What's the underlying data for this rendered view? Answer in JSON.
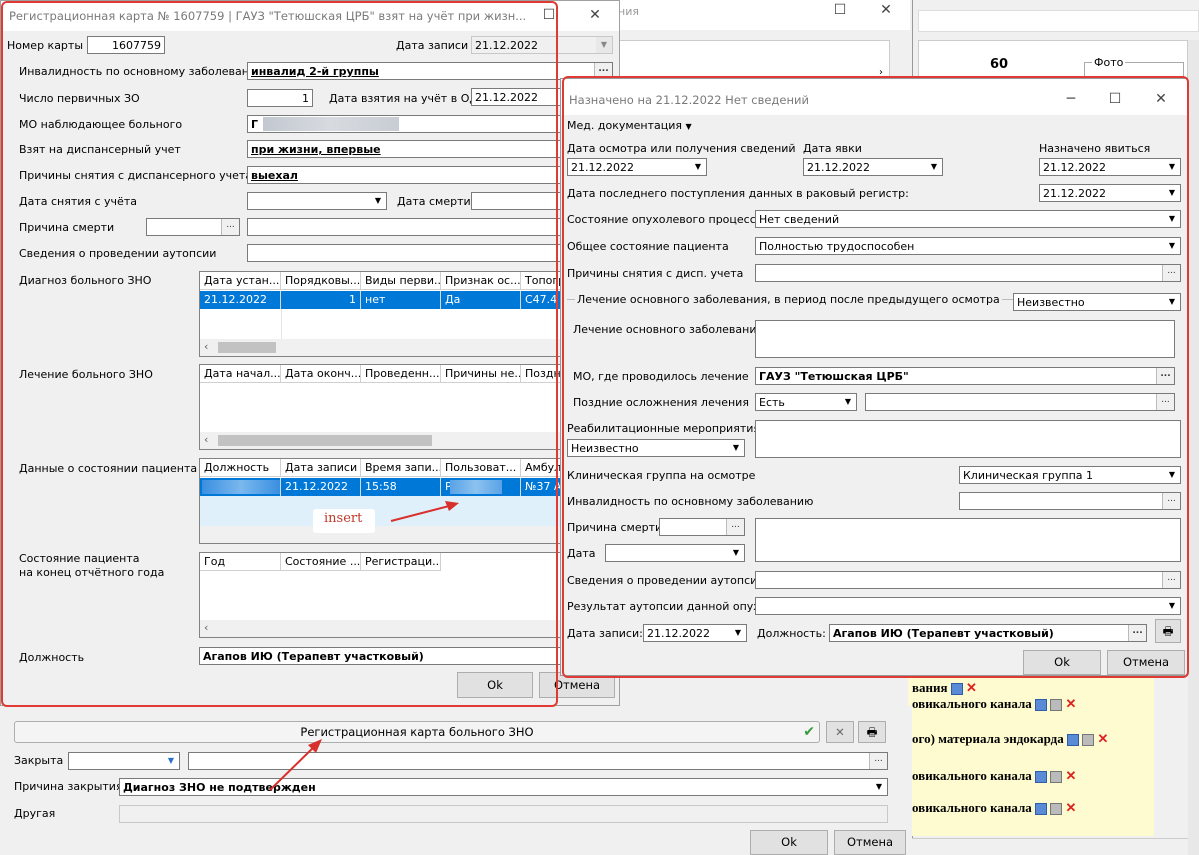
{
  "bg_window": {
    "title_fragment": "ния",
    "header_number": "60",
    "photo_label": "Фото",
    "yellow_items": [
      "вания",
      "овикального канала",
      "ого) материала эндокарда",
      "овикального канала",
      "овикального канала"
    ]
  },
  "reg_card": {
    "title": "Регистрационная карта № 1607759 |  ГАУЗ \"Тетюшская ЦРБ\" взят на учёт при жизн...",
    "card_number_label": "Номер карты",
    "card_number": "1607759",
    "record_date_label": "Дата записи",
    "record_date": "21.12.2022",
    "disability_label": "Инвалидность по основному заболеванию",
    "disability": "инвалид 2-й группы",
    "primary_count_label": "Число первичных ЗО",
    "primary_count": "1",
    "od_date_label": "Дата взятия на учёт в ОД",
    "od_date": "21.12.2022",
    "mo_label": "МО наблюдающее больного",
    "mo_value": "Г",
    "dispensary_label": "Взят на диспансерный учет",
    "dispensary": "при жизни, впервые",
    "removal_reason_label": "Причины снятия с диспансерного учета",
    "removal_reason": "выехал",
    "removal_date_label": "Дата снятия с учёта",
    "death_date_label": "Дата смерти",
    "death_cause_label": "Причина смерти",
    "autopsy_label": "Сведения о проведении аутопсии",
    "diagnosis_label": "Диагноз больного ЗНО",
    "diagnosis_headers": [
      "Дата устан...",
      "Порядковы...",
      "Виды перви...",
      "Признак ос...",
      "Топогр"
    ],
    "diagnosis_row": [
      "21.12.2022",
      "1",
      "нет",
      "Да",
      "C47.4"
    ],
    "treatment_label": "Лечение больного ЗНО",
    "treatment_headers": [
      "Дата начал...",
      "Дата оконч...",
      "Проведенн...",
      "Причины не...",
      "Поздн"
    ],
    "patient_state_label": "Данные о состоянии пациента",
    "state_headers": [
      "Должность",
      "Дата записи",
      "Время запи...",
      "Пользоват...",
      "Амбул"
    ],
    "state_row": [
      "",
      "21.12.2022",
      "15:58",
      "Р",
      "№37 А"
    ],
    "insert_note": "insert",
    "year_end_label_1": "Состояние  пациента",
    "year_end_label_2": "на конец отчётного года",
    "year_end_headers": [
      "Год",
      "Состояние ...",
      "Регистраци..."
    ],
    "position_label": "Должность",
    "position": "Агапов ИЮ (Терапевт участковый)",
    "ok": "Ok",
    "cancel": "Отмена"
  },
  "bottom": {
    "reg_card_button": "Регистрационная карта больного ЗНО",
    "closed_label": "Закрыта",
    "close_reason_label": "Причина закрытия",
    "close_reason": "Диагноз ЗНО не подтвержден",
    "other_label": "Другая",
    "ok": "Ok",
    "cancel": "Отмена"
  },
  "assigned": {
    "title": "Назначено на 21.12.2022 Нет сведений",
    "menu": "Мед. документация",
    "exam_date_label": "Дата осмотра или получения сведений",
    "exam_date": "21.12.2022",
    "visit_date_label": "Дата явки",
    "visit_date": "21.12.2022",
    "appointed_label": "Назначено явиться",
    "appointed": "21.12.2022",
    "last_data_label": "Дата последнего поступления данных в раковый регистр:",
    "last_data": "21.12.2022",
    "tumor_label": "Состояние опухолевого процесса",
    "tumor": "Нет сведений",
    "general_label": "Общее состояние пациента",
    "general": "Полностью трудоспособен",
    "removal_label": "Причины снятия с дисп. учета",
    "treatment_period_label": "Лечение основного заболевания, в период после предыдущего осмотра",
    "treatment_period": "Неизвестно",
    "treatment_label": "Лечение основного заболевания",
    "mo_label": "МО, где проводилось лечение",
    "mo": "ГАУЗ \"Тетюшская ЦРБ\"",
    "complications_label": "Поздние осложнения лечения",
    "complications": "Есть",
    "rehab_label": "Реабилитационные мероприятия",
    "rehab": "Неизвестно",
    "clinical_group_label": "Клиническая группа на осмотре",
    "clinical_group": "Клиническая группа 1",
    "disability_label": "Инвалидность по основному заболеванию",
    "death_cause_label": "Причина смерти",
    "date_label": "Дата",
    "autopsy_label": "Сведения о проведении аутопсии:",
    "autopsy_result_label": "Результат аутопсии данной опухоли",
    "record_date_label": "Дата записи:",
    "record_date": "21.12.2022",
    "position_label": "Должность:",
    "position": "Агапов ИЮ (Терапевт участковый)",
    "ok": "Ok",
    "cancel": "Отмена"
  }
}
